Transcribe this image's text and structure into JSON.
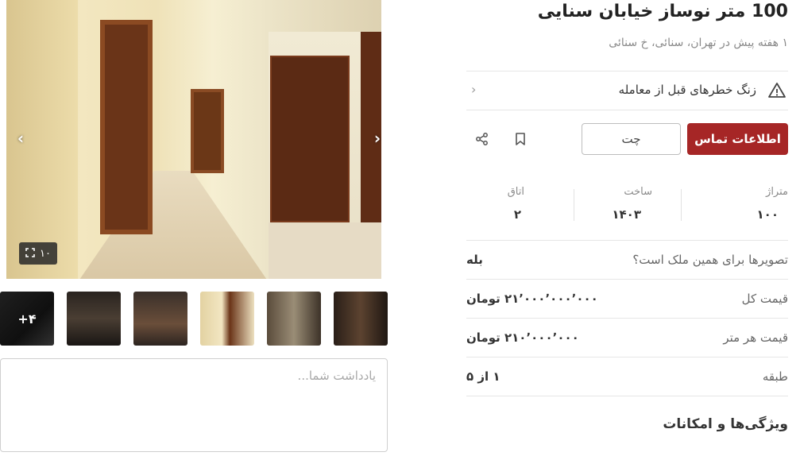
{
  "listing": {
    "title": "100 متر نوساز خیابان سنایی",
    "subtitle": "۱ هفته پیش در تهران، سنائی، خ سنائی"
  },
  "gallery": {
    "photo_count": "۱۰",
    "more_label": "+۴",
    "prev_arrow": "‹",
    "next_arrow": "›"
  },
  "warning": {
    "text": "زنگ خطرهای قبل از معامله",
    "icon": "warning-triangle-icon",
    "chevron": "‹"
  },
  "actions": {
    "contact_label": "اطلاعات تماس",
    "chat_label": "چت",
    "contact_color": "#a62626"
  },
  "stats": [
    {
      "label": "متراژ",
      "value": "۱۰۰"
    },
    {
      "label": "ساخت",
      "value": "۱۴۰۳"
    },
    {
      "label": "اتاق",
      "value": "۲"
    }
  ],
  "details": [
    {
      "key": "تصویرها برای همین ملک است؟",
      "value": "بله"
    },
    {
      "key": "قیمت کل",
      "value": "۲۱٬۰۰۰٬۰۰۰٬۰۰۰ تومان"
    },
    {
      "key": "قیمت هر متر",
      "value": "۲۱۰٬۰۰۰٬۰۰۰ تومان"
    },
    {
      "key": "طبقه",
      "value": "۱ از ۵"
    }
  ],
  "features_title": "ویژگی‌ها و امکانات",
  "note": {
    "placeholder": "یادداشت شما..."
  }
}
